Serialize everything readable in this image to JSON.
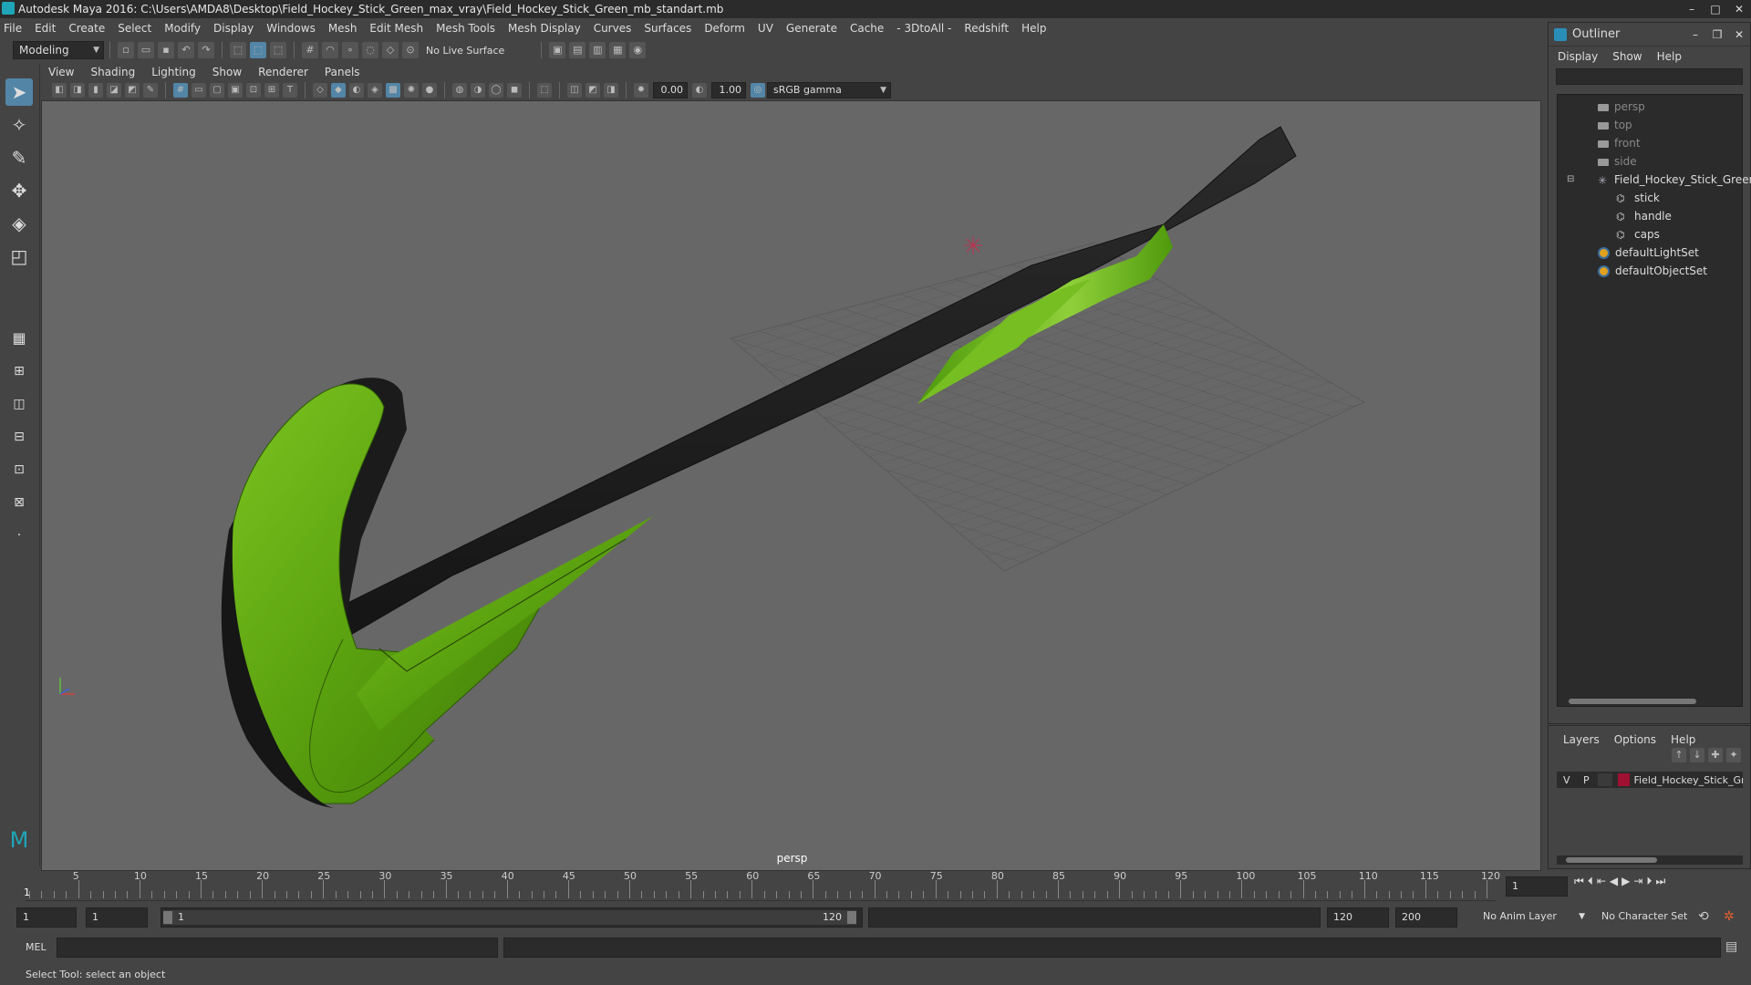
{
  "app": {
    "title": "Autodesk Maya 2016: C:\\Users\\AMDA8\\Desktop\\Field_Hockey_Stick_Green_max_vray\\Field_Hockey_Stick_Green_mb_standart.mb"
  },
  "menubar": [
    "File",
    "Edit",
    "Create",
    "Select",
    "Modify",
    "Display",
    "Windows",
    "Mesh",
    "Edit Mesh",
    "Mesh Tools",
    "Mesh Display",
    "Curves",
    "Surfaces",
    "Deform",
    "UV",
    "Generate",
    "Cache",
    "- 3DtoAll -",
    "Redshift",
    "Help"
  ],
  "shelf": {
    "mode": "Modeling",
    "live_surface": "No Live Surface"
  },
  "viewport": {
    "menu": [
      "View",
      "Shading",
      "Lighting",
      "Show",
      "Renderer",
      "Panels"
    ],
    "exposure": "0.00",
    "gamma": "1.00",
    "colorspace": "sRGB gamma",
    "camera_label": "persp",
    "colors": {
      "stick_green": "#5aa10f",
      "stick_black": "#1e1e1e",
      "bg": "#676767",
      "grid": "#555555"
    }
  },
  "outliner": {
    "title": "Outliner",
    "menu": [
      "Display",
      "Show",
      "Help"
    ],
    "items": [
      {
        "label": "persp",
        "type": "camera"
      },
      {
        "label": "top",
        "type": "camera"
      },
      {
        "label": "front",
        "type": "camera"
      },
      {
        "label": "side",
        "type": "camera"
      },
      {
        "label": "Field_Hockey_Stick_Green",
        "type": "group"
      },
      {
        "label": "stick",
        "type": "mesh"
      },
      {
        "label": "handle",
        "type": "mesh"
      },
      {
        "label": "caps",
        "type": "mesh"
      },
      {
        "label": "defaultLightSet",
        "type": "set"
      },
      {
        "label": "defaultObjectSet",
        "type": "set"
      }
    ]
  },
  "layers": {
    "menu": [
      "Layers",
      "Options",
      "Help"
    ],
    "row": {
      "v": "V",
      "p": "P",
      "name": "Field_Hockey_Stick_Gr",
      "color": "#a01030"
    }
  },
  "timeline": {
    "ticks": [
      "5",
      "10",
      "15",
      "20",
      "25",
      "30",
      "35",
      "40",
      "45",
      "50",
      "55",
      "60",
      "65",
      "70",
      "75",
      "80",
      "85",
      "90",
      "95",
      "100",
      "105",
      "110",
      "115",
      "120"
    ],
    "start_marker": "1",
    "current_frame": "1"
  },
  "range": {
    "start": "1",
    "anim_start": "1",
    "slider_start": "1",
    "slider_end": "120",
    "end": "120",
    "anim_end": "200",
    "anim_layer": "No Anim Layer",
    "char_set": "No Character Set"
  },
  "cmdline": {
    "label": "MEL"
  },
  "helpline": {
    "text": "Select Tool: select an object"
  }
}
